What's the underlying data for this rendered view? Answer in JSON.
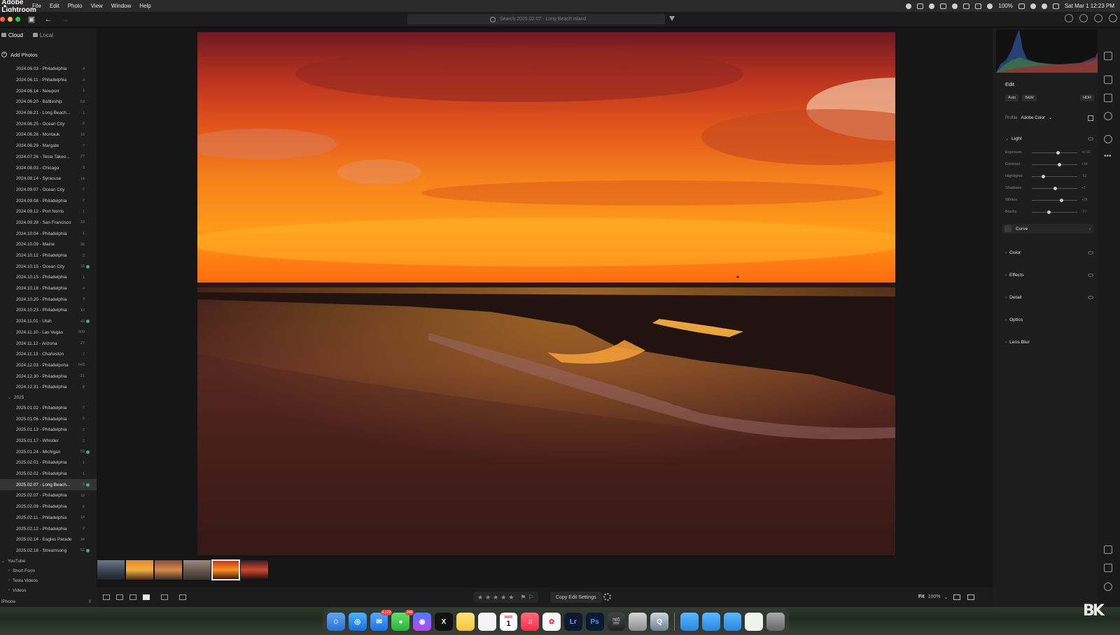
{
  "menubar": {
    "app_name": "Adobe Lightroom",
    "menus": [
      "File",
      "Edit",
      "Photo",
      "View",
      "Window",
      "Help"
    ],
    "battery": "100%",
    "datetime": "Sat Mar 1  12:23 PM"
  },
  "toolbar": {
    "search_placeholder": "Search 2025.02.07 - Long Beach Island"
  },
  "sidebar": {
    "tabs": [
      {
        "label": "Cloud",
        "active": true
      },
      {
        "label": "Local",
        "active": false
      }
    ],
    "add_photos": "Add Photos",
    "albums_2024": [
      {
        "name": "2024.06.03 - Philadelphia",
        "count": "4"
      },
      {
        "name": "2024.06.11 - Philadelphia",
        "count": "4"
      },
      {
        "name": "2024.06.14 - Newport",
        "count": "1"
      },
      {
        "name": "2024.06.20 - Battleship",
        "count": "63"
      },
      {
        "name": "2024.06.21 - Long Beach...",
        "count": "1"
      },
      {
        "name": "2024.06.25 - Ocean City",
        "count": "2"
      },
      {
        "name": "2024.06.28 - Montauk",
        "count": "16"
      },
      {
        "name": "2024.06.29 - Margate",
        "count": "7"
      },
      {
        "name": "2024.07.26 - Tesla Takeo...",
        "count": "27"
      },
      {
        "name": "2024.08.03 - Chicago",
        "count": "3"
      },
      {
        "name": "2024.08.14 - Syracuse",
        "count": "14"
      },
      {
        "name": "2024.09.07 - Ocean City",
        "count": "2"
      },
      {
        "name": "2024.09.08 - Philadelphia",
        "count": "2"
      },
      {
        "name": "2024.09.12 - Port Norris",
        "count": "1"
      },
      {
        "name": "2024.09.28 - San Francisco",
        "count": "33"
      },
      {
        "name": "2024.10.04 - Philadelphia",
        "count": "1"
      },
      {
        "name": "2024.10.09 - Maine",
        "count": "26"
      },
      {
        "name": "2024.10.12 - Philadelphia",
        "count": "3"
      },
      {
        "name": "2024.10.15 - Ocean City",
        "count": "18",
        "sync": true
      },
      {
        "name": "2024.10.15 - Philadelphia",
        "count": "1"
      },
      {
        "name": "2024.10.18 - Philadelphia",
        "count": "4"
      },
      {
        "name": "2024.10.20 - Philadelphia",
        "count": "3"
      },
      {
        "name": "2024.10.23 - Philadelphia",
        "count": "12"
      },
      {
        "name": "2024.11.01 - Utah",
        "count": "43",
        "sync": true
      },
      {
        "name": "2024.11.10 - Las Vegas",
        "count": "509"
      },
      {
        "name": "2024.11.12 - Arizona",
        "count": "27"
      },
      {
        "name": "2024.11.13 - Charleston",
        "count": "7"
      },
      {
        "name": "2024.12.03 - Philadelpoha",
        "count": "643"
      },
      {
        "name": "2024.12.30 - Philadelphia",
        "count": "21"
      },
      {
        "name": "2024.12.31 - Philadelphia",
        "count": "8"
      }
    ],
    "group_2025": "2025",
    "albums_2025": [
      {
        "name": "2025.01.02 - Philadelphia",
        "count": "2"
      },
      {
        "name": "2025.01.06 - Philadelphia",
        "count": "5"
      },
      {
        "name": "2025.01.13 - Philadelphia",
        "count": "2"
      },
      {
        "name": "2025.01.17 - Whistler",
        "count": "2"
      },
      {
        "name": "2025.01.24 - Michigan",
        "count": "59",
        "sync": true
      },
      {
        "name": "2025.02.01 - Philadelphia",
        "count": "1"
      },
      {
        "name": "2025.02.02 - Philadelphia",
        "count": "1"
      },
      {
        "name": "2025.02.07 - Long Beach...",
        "count": "6",
        "sync": true,
        "selected": true
      },
      {
        "name": "2025.02.07 - Philadelphia",
        "count": "19"
      },
      {
        "name": "2025.02.09 - Philadelphia",
        "count": "8"
      },
      {
        "name": "2025.02.11 - Philadelphia",
        "count": "14"
      },
      {
        "name": "2025.02.12 - Philadelphia",
        "count": "2"
      },
      {
        "name": "2025.02.14 - Eagles Parade",
        "count": "34"
      },
      {
        "name": "2025.02.18 - Streamsong",
        "count": "52",
        "sync": true
      }
    ],
    "youtube_group": "YouTube",
    "youtube_folders": [
      "Short Form",
      "Tesla Videos",
      "Videos"
    ],
    "iphone": {
      "label": "iPhone",
      "count": "8"
    }
  },
  "bottombar": {
    "copy_edit_settings": "Copy Edit Settings",
    "fit_label": "Fit",
    "zoom_label": "100%"
  },
  "edit": {
    "title": "Edit",
    "buttons": [
      "Auto",
      "B&W"
    ],
    "hdr": "HDR",
    "profile_label": "Profile",
    "profile_value": "Adobe Color",
    "light_label": "Light",
    "sliders": [
      {
        "label": "Exposure",
        "value": "+0.92",
        "pos": 0.58
      },
      {
        "label": "Contrast",
        "value": "+18",
        "pos": 0.6
      },
      {
        "label": "Highlights",
        "value": "-52",
        "pos": 0.26
      },
      {
        "label": "Shadows",
        "value": "+3",
        "pos": 0.52
      },
      {
        "label": "Whites",
        "value": "+28",
        "pos": 0.66
      },
      {
        "label": "Blacks",
        "value": "-27",
        "pos": 0.37
      }
    ],
    "curve_label": "Curve",
    "sections": [
      "Color",
      "Effects",
      "Detail",
      "Optics",
      "Lens Blur"
    ]
  },
  "dock": {
    "mail_badge": "4,122",
    "messages_badge": "240",
    "calendar_month": "MAR",
    "calendar_day": "1",
    "lr_label": "Lr",
    "ps_label": "Ps"
  },
  "watermark": "BK",
  "colors": {
    "accent": "#3fae8f",
    "sky_top": "#7a1f24",
    "sky_mid": "#f07a1e",
    "horizon": "#ff8a10"
  }
}
